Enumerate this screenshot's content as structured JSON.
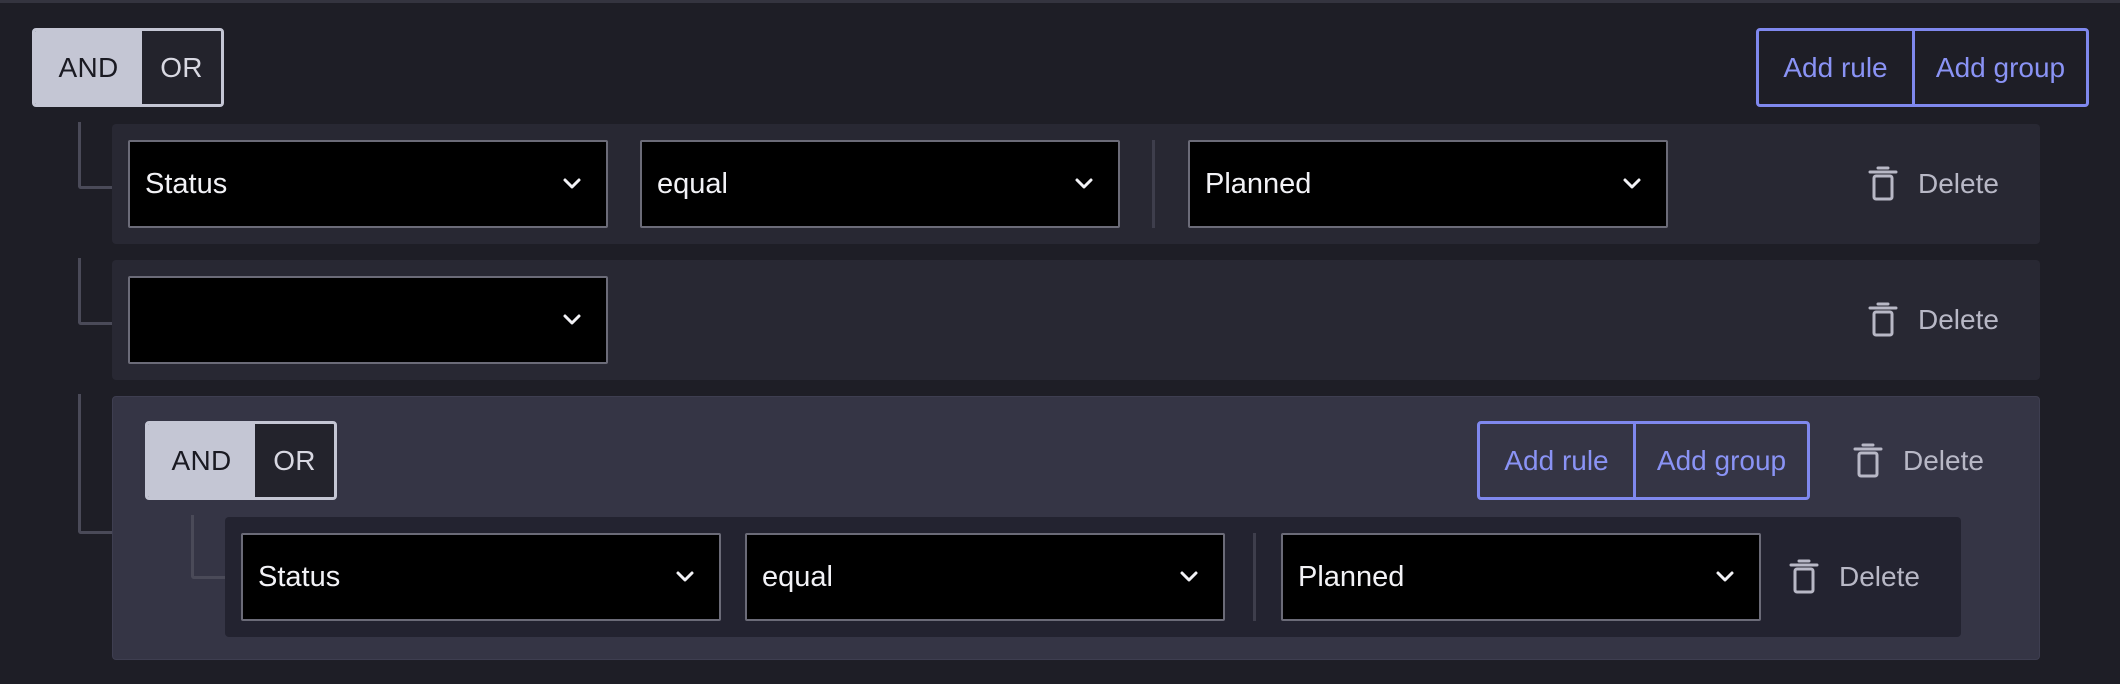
{
  "root": {
    "combinator": {
      "and_label": "AND",
      "or_label": "OR",
      "selected": "AND"
    },
    "add_rule_label": "Add rule",
    "add_group_label": "Add group"
  },
  "rules": [
    {
      "field": "Status",
      "operator": "equal",
      "value": "Planned",
      "delete_label": "Delete"
    },
    {
      "field": "",
      "delete_label": "Delete"
    }
  ],
  "group": {
    "combinator": {
      "and_label": "AND",
      "or_label": "OR",
      "selected": "AND"
    },
    "add_rule_label": "Add rule",
    "add_group_label": "Add group",
    "delete_label": "Delete",
    "rules": [
      {
        "field": "Status",
        "operator": "equal",
        "value": "Planned",
        "delete_label": "Delete"
      }
    ]
  },
  "icons": {
    "chevron": "chevron-down-icon",
    "trash": "trash-icon"
  },
  "colors": {
    "background": "#1e1e26",
    "accent": "#7f88ee",
    "toggle_selected": "#c4c6d4"
  }
}
